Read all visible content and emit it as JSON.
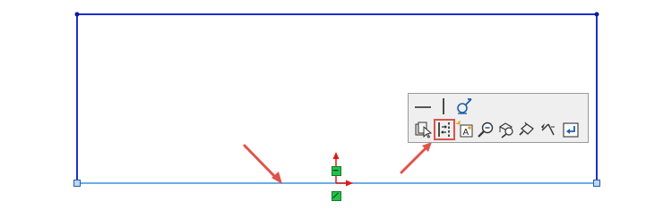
{
  "colors": {
    "sketch_line": "#1f2fd0",
    "selected_line": "#6aaee8",
    "endpoint": "#0c1a9c",
    "callout_arrow": "#e0534a",
    "toolbar_bg": "#efefef",
    "relation_tag": "#22c24a",
    "origin_red": "#e01a1a"
  },
  "context_toolbar": {
    "row1": [
      {
        "name": "horizontal-relation-icon"
      },
      {
        "name": "vertical-relation-icon"
      },
      {
        "name": "fix-relation-icon"
      }
    ],
    "row2": [
      {
        "name": "select-other-icon"
      },
      {
        "name": "convert-to-construction-icon",
        "highlighted": true
      },
      {
        "name": "add-dimension-icon"
      },
      {
        "name": "zoom-to-selection-icon"
      },
      {
        "name": "display-relations-icon"
      },
      {
        "name": "sketch-tools-icon"
      },
      {
        "name": "smart-dimension-icon"
      },
      {
        "name": "exit-sketch-icon"
      }
    ]
  }
}
